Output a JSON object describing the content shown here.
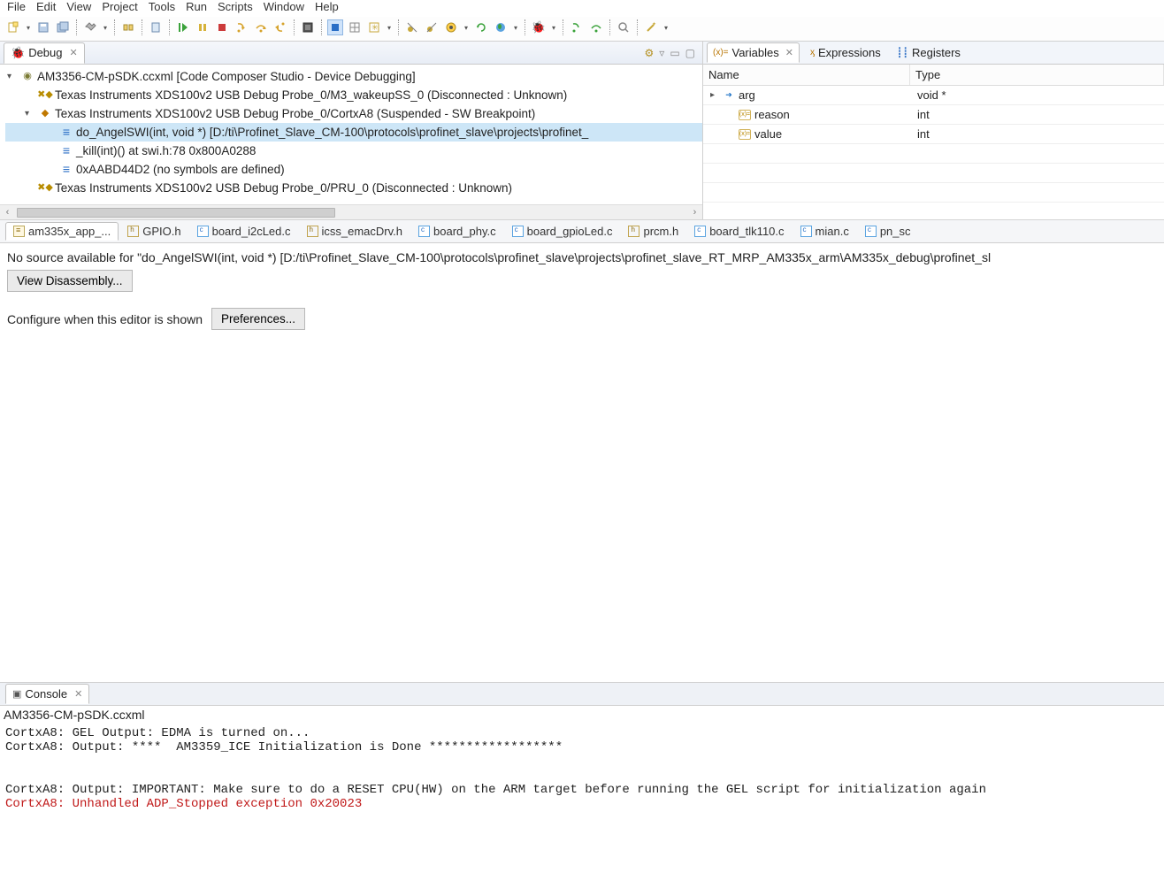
{
  "menu": [
    "File",
    "Edit",
    "View",
    "Project",
    "Tools",
    "Run",
    "Scripts",
    "Window",
    "Help"
  ],
  "debug": {
    "tab": "Debug",
    "root": "AM3356-CM-pSDK.ccxml [Code Composer Studio - Device Debugging]",
    "probe_m3": "Texas Instruments XDS100v2 USB Debug Probe_0/M3_wakeupSS_0 (Disconnected : Unknown)",
    "probe_a8": "Texas Instruments XDS100v2 USB Debug Probe_0/CortxA8 (Suspended - SW Breakpoint)",
    "stack0": "do_AngelSWI(int, void *) [D:/ti\\Profinet_Slave_CM-100\\protocols\\profinet_slave\\projects\\profinet_",
    "stack1": "_kill(int)() at swi.h:78 0x800A0288",
    "stack2": "0xAABD44D2  (no symbols are defined)",
    "probe_pru": "Texas Instruments XDS100v2 USB Debug Probe_0/PRU_0 (Disconnected : Unknown)"
  },
  "vars": {
    "tab_variables": "Variables",
    "tab_expressions": "Expressions",
    "tab_registers": "Registers",
    "head_name": "Name",
    "head_type": "Type",
    "rows": [
      {
        "name": "arg",
        "type": "void *",
        "kind": "arrow",
        "indent": 0,
        "twisty": "▸"
      },
      {
        "name": "reason",
        "type": "int",
        "kind": "var",
        "indent": 1,
        "twisty": ""
      },
      {
        "name": "value",
        "type": "int",
        "kind": "var",
        "indent": 1,
        "twisty": ""
      }
    ]
  },
  "files": [
    {
      "label": "am335x_app_...",
      "icon": "g",
      "active": true
    },
    {
      "label": "GPIO.h",
      "icon": "h"
    },
    {
      "label": "board_i2cLed.c",
      "icon": "c"
    },
    {
      "label": "icss_emacDrv.h",
      "icon": "h"
    },
    {
      "label": "board_phy.c",
      "icon": "c"
    },
    {
      "label": "board_gpioLed.c",
      "icon": "c"
    },
    {
      "label": "prcm.h",
      "icon": "h"
    },
    {
      "label": "board_tlk110.c",
      "icon": "c"
    },
    {
      "label": "mian.c",
      "icon": "c"
    },
    {
      "label": "pn_sc",
      "icon": "c"
    }
  ],
  "editor": {
    "nosrc": "No source available for \"do_AngelSWI(int, void *) [D:/ti\\Profinet_Slave_CM-100\\protocols\\profinet_slave\\projects\\profinet_slave_RT_MRP_AM335x_arm\\AM335x_debug\\profinet_sl",
    "view_disasm": "View Disassembly...",
    "cfg_label": "Configure when this editor is shown",
    "prefs": "Preferences..."
  },
  "console": {
    "tab": "Console",
    "title": "AM3356-CM-pSDK.ccxml",
    "lines": [
      {
        "text": "CortxA8: GEL Output: EDMA is turned on...",
        "red": false
      },
      {
        "text": "CortxA8: Output: ****  AM3359_ICE Initialization is Done ******************",
        "red": false
      },
      {
        "text": "",
        "red": false
      },
      {
        "text": "",
        "red": false
      },
      {
        "text": "CortxA8: Output: IMPORTANT: Make sure to do a RESET CPU(HW) on the ARM target before running the GEL script for initialization again",
        "red": false
      },
      {
        "text": "CortxA8: Unhandled ADP_Stopped exception 0x20023",
        "red": true
      }
    ]
  }
}
